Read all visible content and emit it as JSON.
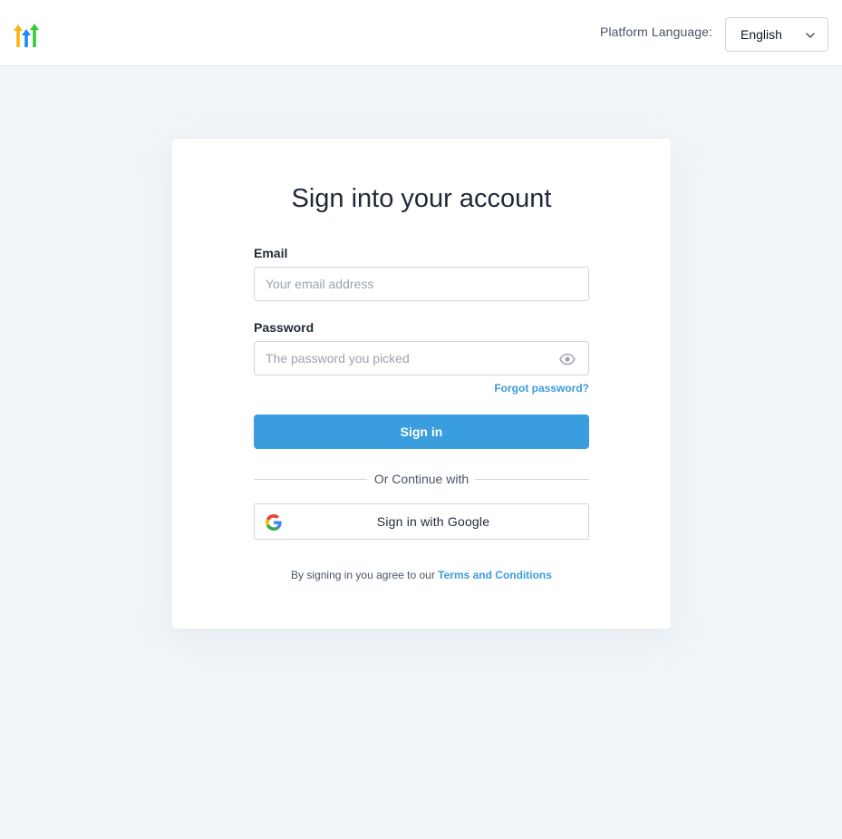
{
  "header": {
    "logo_icon": "highlevel-arrows-logo",
    "language_label": "Platform Language:",
    "language_value": "English"
  },
  "form": {
    "title": "Sign into your account",
    "email": {
      "label": "Email",
      "placeholder": "Your email address",
      "value": ""
    },
    "password": {
      "label": "Password",
      "placeholder": "The password you picked",
      "value": ""
    },
    "forgot_label": "Forgot password?",
    "signin_label": "Sign in",
    "divider_text": "Or Continue with",
    "google_label": "Sign in with Google",
    "terms_prefix": "By signing in you agree to our",
    "terms_link": "Terms and Conditions"
  },
  "colors": {
    "accent": "#3a9ddd",
    "background": "#f1f5f8",
    "card": "#ffffff"
  }
}
